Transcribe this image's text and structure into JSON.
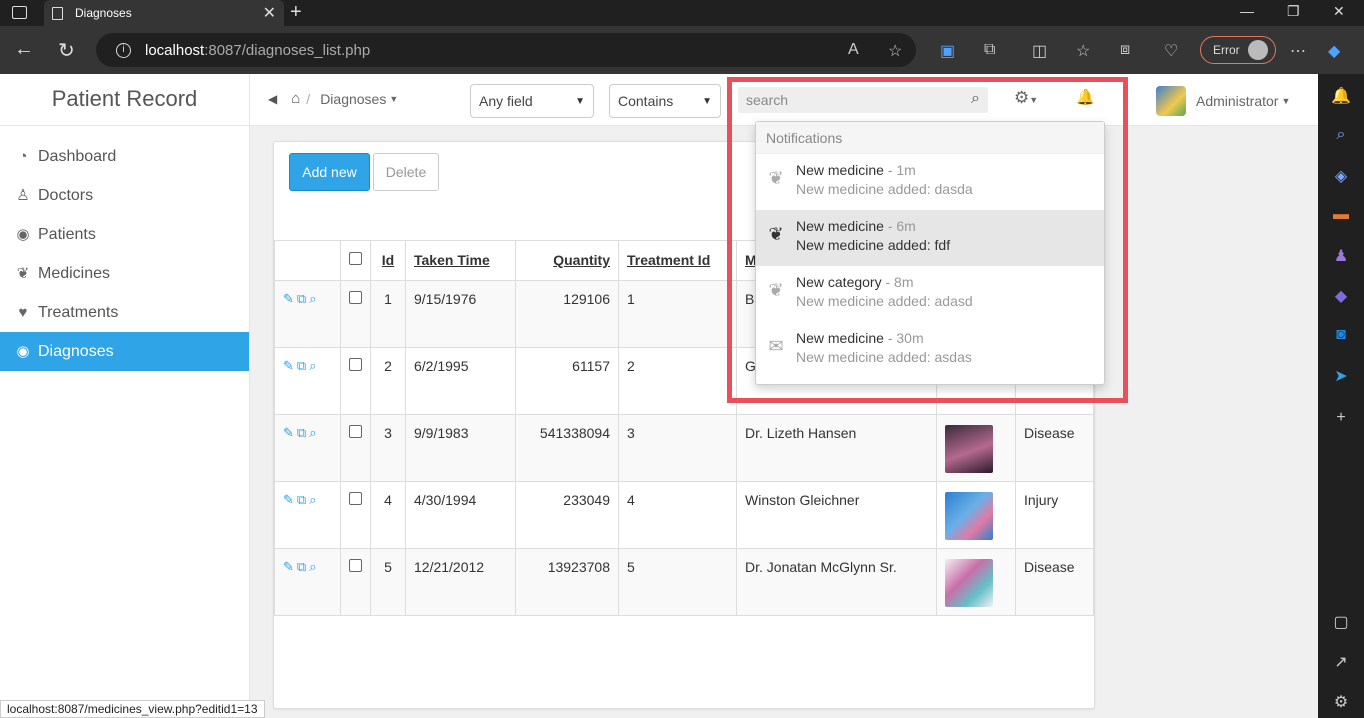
{
  "browser": {
    "tab_title": "Diagnoses",
    "url_host": "localhost",
    "url_rest": ":8087/diagnoses_list.php",
    "error_label": "Error",
    "status_url": "localhost:8087/medicines_view.php?editid1=13"
  },
  "sidebar": {
    "brand": "Patient Record",
    "items": [
      {
        "label": "Dashboard",
        "icon": "dashboard-icon"
      },
      {
        "label": "Doctors",
        "icon": "user-md-icon"
      },
      {
        "label": "Patients",
        "icon": "user-circle-icon"
      },
      {
        "label": "Medicines",
        "icon": "leaf-icon"
      },
      {
        "label": "Treatments",
        "icon": "heart-icon"
      },
      {
        "label": "Diagnoses",
        "icon": "eye-icon",
        "active": true
      }
    ]
  },
  "topnav": {
    "breadcrumb": "Diagnoses",
    "field_select": "Any field",
    "op_select": "Contains",
    "search_placeholder": "search",
    "user": "Administrator"
  },
  "toolbar": {
    "add_label": "Add new",
    "delete_label": "Delete"
  },
  "table": {
    "columns": [
      "Id",
      "Taken Time",
      "Quantity",
      "Treatment Id",
      "M"
    ],
    "rows": [
      {
        "id": "1",
        "taken": "9/15/1976",
        "qty": "129106",
        "treat": "1",
        "doctor": "Bi",
        "type": ""
      },
      {
        "id": "2",
        "taken": "6/2/1995",
        "qty": "61157",
        "treat": "2",
        "doctor": "G",
        "type": ""
      },
      {
        "id": "3",
        "taken": "9/9/1983",
        "qty": "541338094",
        "treat": "3",
        "doctor": "Dr. Lizeth Hansen",
        "type": "Disease"
      },
      {
        "id": "4",
        "taken": "4/30/1994",
        "qty": "233049",
        "treat": "4",
        "doctor": "Winston Gleichner",
        "type": "Injury"
      },
      {
        "id": "5",
        "taken": "12/21/2012",
        "qty": "13923708",
        "treat": "5",
        "doctor": "Dr. Jonatan McGlynn Sr.",
        "type": "Disease"
      }
    ]
  },
  "notifications": {
    "header": "Notifications",
    "items": [
      {
        "title": "New medicine",
        "ago": "- 1m",
        "desc": "New medicine added: dasda",
        "icon": "leaf-icon"
      },
      {
        "title": "New medicine",
        "ago": "- 6m",
        "desc": "New medicine added: fdf",
        "icon": "leaf-icon",
        "active": true
      },
      {
        "title": "New category",
        "ago": "- 8m",
        "desc": "New medicine added: adasd",
        "icon": "leaf-icon"
      },
      {
        "title": "New medicine",
        "ago": "- 30m",
        "desc": "New medicine added: asdas",
        "icon": "envelope-icon"
      }
    ]
  },
  "colors": {
    "accent": "#2fa4e7",
    "highlight_frame": "#e8505b"
  }
}
